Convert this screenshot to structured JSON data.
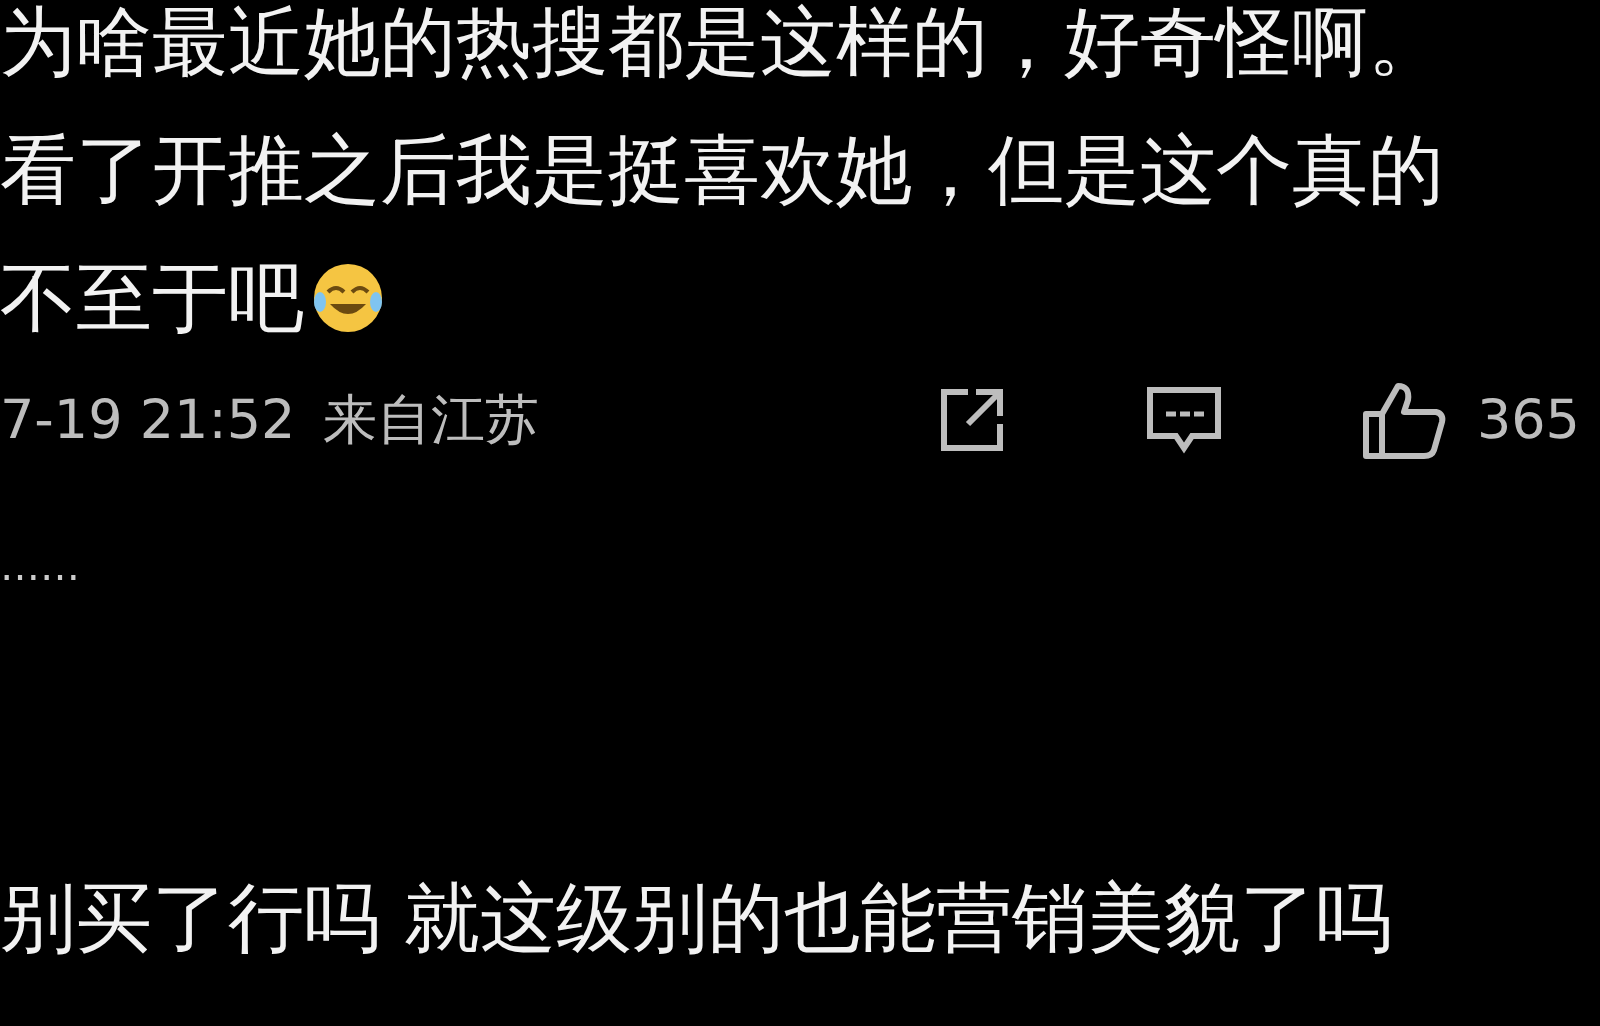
{
  "post": {
    "lines": [
      "为啥最近她的热搜都是这样的，好奇怪啊。",
      "看了开推之后我是挺喜欢她，但是这个真的",
      "不至于吧"
    ],
    "meta": {
      "time": "7-19 21:52",
      "location": "来自江苏",
      "likes": "365"
    }
  },
  "reply_preview": {
    "text": "……"
  },
  "reply": {
    "text": "别买了行吗 就这级别的也能营销美貌了吗"
  }
}
